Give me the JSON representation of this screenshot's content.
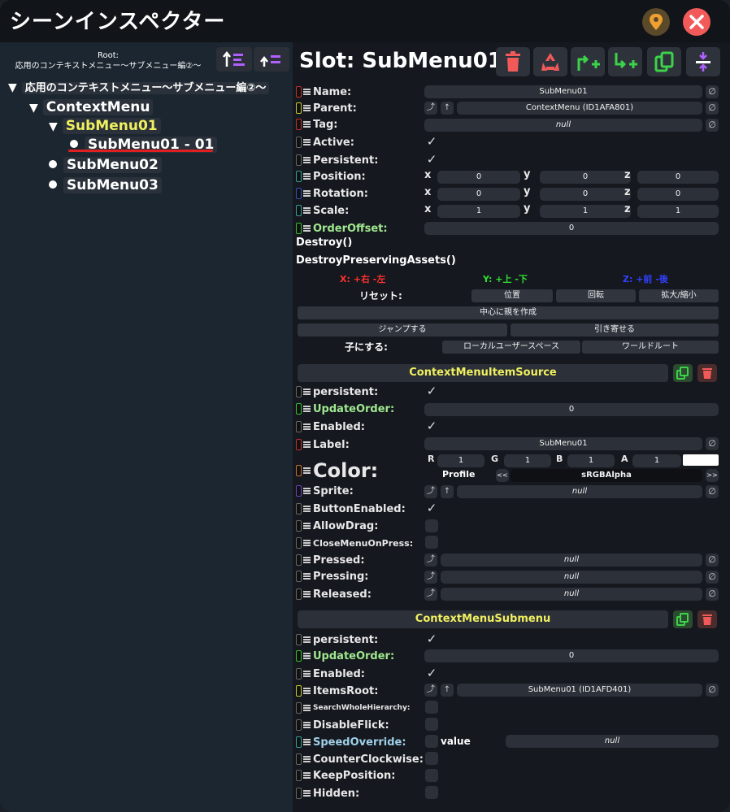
{
  "window": {
    "title": "シーンインスペクター",
    "pin_icon": "pin-icon",
    "close_icon": "close-icon"
  },
  "hierarchy": {
    "root_line1": "Root:",
    "root_line2": "応用のコンテキストメニュー〜サブメニュー編②〜",
    "items": [
      {
        "label": "応用のコンテキストメニュー〜サブメニュー編②〜",
        "marker": "▼"
      },
      {
        "label": "ContextMenu",
        "marker": "▼"
      },
      {
        "label": "SubMenu01",
        "marker": "▼"
      },
      {
        "label": "SubMenu01 - 01",
        "marker": "●"
      },
      {
        "label": "SubMenu02",
        "marker": "●"
      },
      {
        "label": "SubMenu03",
        "marker": "●"
      }
    ]
  },
  "slot": {
    "title": "Slot: SubMenu01",
    "fields": {
      "name": {
        "label": "Name:",
        "value": "SubMenu01"
      },
      "parent": {
        "label": "Parent:",
        "value": "ContextMenu (ID1AFA801)"
      },
      "tag": {
        "label": "Tag:",
        "value": "null"
      },
      "active": {
        "label": "Active:"
      },
      "persistent": {
        "label": "Persistent:"
      },
      "position": {
        "label": "Position:",
        "x": "0",
        "y": "0",
        "z": "0"
      },
      "rotation": {
        "label": "Rotation:",
        "x": "0",
        "y": "0",
        "z": "0"
      },
      "scale": {
        "label": "Scale:",
        "x": "1",
        "y": "1",
        "z": "1"
      },
      "orderoffset": {
        "label": "OrderOffset:",
        "value": "0"
      }
    },
    "axis": {
      "x": "x",
      "y": "y",
      "z": "z"
    },
    "methods": {
      "destroy": "Destroy()",
      "destroy_preserving": "DestroyPreservingAssets()"
    },
    "axes_legend": {
      "x": "X: +右 -左",
      "y": "Y: +上 -下",
      "z": "Z: +前 -後"
    },
    "reset": {
      "label": "リセット:",
      "position": "位置",
      "rotation": "回転",
      "scale": "拡大/縮小"
    },
    "create_parent": "中心に親を作成",
    "jump": "ジャンプする",
    "pull": "引き寄せる",
    "make_child": {
      "label": "子にする:",
      "local_user_space": "ローカルユーザースペース",
      "world_root": "ワールドルート"
    }
  },
  "comp1": {
    "title": "ContextMenuItemSource",
    "persistent": "persistent:",
    "update_order": {
      "label": "UpdateOrder:",
      "value": "0"
    },
    "enabled": "Enabled:",
    "label": {
      "label": "Label:",
      "value": "SubMenu01"
    },
    "color": {
      "label": "Color:",
      "r": "1",
      "g": "1",
      "b": "1",
      "a": "1",
      "r_lbl": "R",
      "g_lbl": "G",
      "b_lbl": "B",
      "a_lbl": "A",
      "profile_label": "Profile",
      "profile": "sRGBAlpha",
      "prev": "<<",
      "next": ">>"
    },
    "sprite": {
      "label": "Sprite:",
      "value": "null"
    },
    "button_enabled": "ButtonEnabled:",
    "allow_drag": "AllowDrag:",
    "close_on_press": "CloseMenuOnPress:",
    "pressed": {
      "label": "Pressed:",
      "value": "null"
    },
    "pressing": {
      "label": "Pressing:",
      "value": "null"
    },
    "released": {
      "label": "Released:",
      "value": "null"
    }
  },
  "comp2": {
    "title": "ContextMenuSubmenu",
    "persistent": "persistent:",
    "update_order": {
      "label": "UpdateOrder:",
      "value": "0"
    },
    "enabled": "Enabled:",
    "items_root": {
      "label": "ItemsRoot:",
      "value": "SubMenu01 (ID1AFD401)"
    },
    "search_whole": "SearchWholeHierarchy:",
    "disable_flick": "DisableFlick:",
    "speed_override": {
      "label": "SpeedOverride:",
      "sub": "value",
      "value": "null"
    },
    "counter_clockwise": "CounterClockwise:",
    "keep_position": "KeepPosition:",
    "hidden": "Hidden:"
  },
  "glyphs": {
    "check": "✓",
    "null_x": "∅",
    "jump": "⤴",
    "up": "↑"
  },
  "colors": {
    "accent_yellow": "#f0f060",
    "red": "#f25a5a",
    "green": "#3cd24a",
    "purple": "#b060ff",
    "x_axis": "#ff3030",
    "y_axis": "#30e030",
    "z_axis": "#3040ff"
  }
}
